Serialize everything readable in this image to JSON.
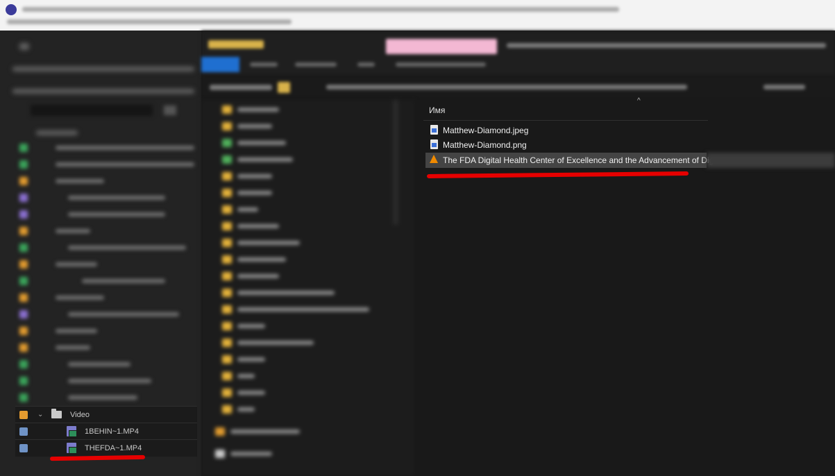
{
  "left_panel": {
    "video_folder": {
      "label": "Video"
    },
    "files": [
      {
        "label": "1BEHIN~1.MP4"
      },
      {
        "label": "THEFDA~1.MP4"
      }
    ]
  },
  "explorer": {
    "column_header": "Имя",
    "files": [
      {
        "name": "Matthew-Diamond.jpeg",
        "icon": "image-file-icon"
      },
      {
        "name": "Matthew-Diamond.png",
        "icon": "image-file-icon"
      },
      {
        "name": "The FDA Digital Health Center of Excellence and the Advancement of Dig",
        "icon": "vlc-cone-icon",
        "selected": true
      }
    ]
  },
  "colors": {
    "annotation_red": "#e60000",
    "folder_yellow": "#e2b03a",
    "selection_gray": "#444444"
  }
}
